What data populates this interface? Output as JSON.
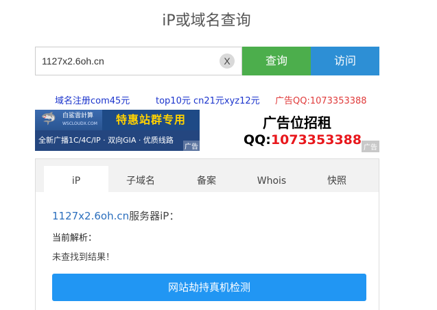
{
  "page": {
    "title": "iP或域名查询"
  },
  "search": {
    "value": "1127x2.6oh.cn",
    "clear_label": "X",
    "query_label": "查询",
    "visit_label": "访问"
  },
  "ad_links": [
    {
      "text": "域名注册com45元",
      "color": "#1a33cc"
    },
    {
      "text": "top10元 cn21元xyz12元",
      "color": "#1a33cc"
    },
    {
      "text": "广告QQ:1073353388",
      "color": "#e03a3a"
    }
  ],
  "banner": {
    "brand": "白鲨雲計算",
    "brand_sub": "WSCLOUDX.COM",
    "headline": "特惠站群专用",
    "subline": "全新广播1C/4C/IP · 双向GIA · 优质线路",
    "ad_tag": "广告"
  },
  "rent_ad": {
    "title": "广告位招租",
    "qq_prefix": "QQ:",
    "qq_number": "1073353388",
    "ad_tag": "广告"
  },
  "tabs": [
    {
      "label": "iP",
      "active": true
    },
    {
      "label": "子域名",
      "active": false
    },
    {
      "label": "备案",
      "active": false
    },
    {
      "label": "Whois",
      "active": false
    },
    {
      "label": "快照",
      "active": false
    }
  ],
  "result": {
    "domain": "1127x2.6oh.cn",
    "suffix": "服务器iP：",
    "label": "当前解析：",
    "empty_text": "未查找到结果！",
    "button_label": "网站劫持真机检测"
  },
  "colors": {
    "query_button": "#4cae4c",
    "visit_button": "#2d8fd5",
    "check_button": "#2196f3",
    "qq_number": "#e8171c"
  }
}
